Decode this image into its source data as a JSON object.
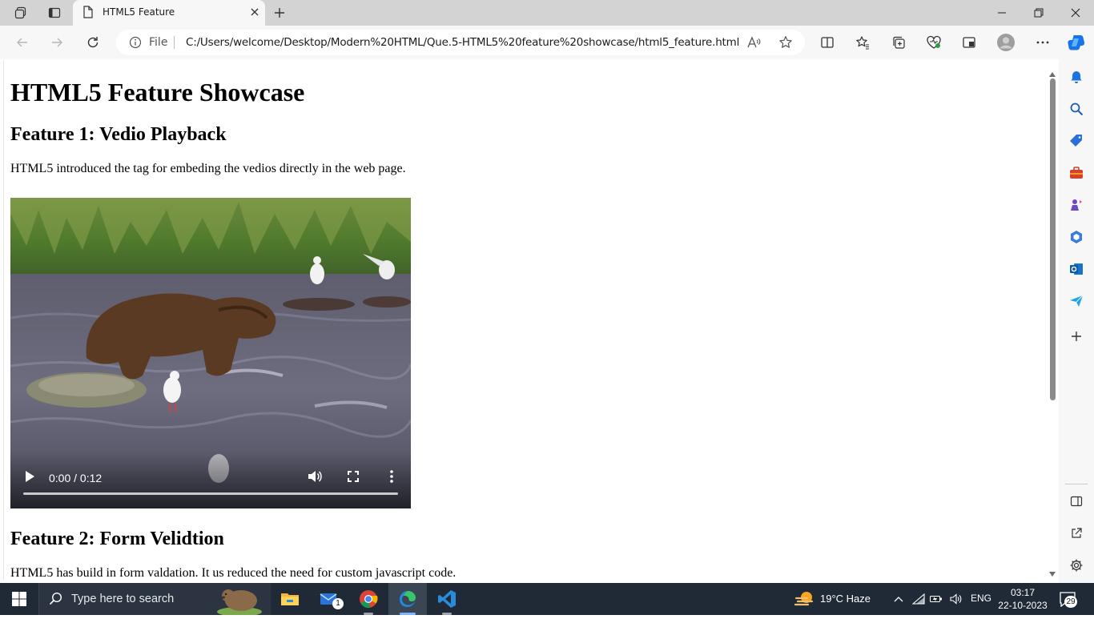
{
  "browser": {
    "tab": {
      "title": "HTML5 Feature"
    },
    "address": {
      "scheme_label": "File",
      "url": "C:/Users/welcome/Desktop/Modern%20HTML/Que.5-HTML5%20feature%20showcase/html5_feature.html"
    }
  },
  "page": {
    "title": "HTML5 Feature Showcase",
    "feature1": {
      "heading": "Feature 1: Vedio Playback",
      "text": "HTML5 introduced the tag for embeding the vedios directly in the web page.",
      "video": {
        "time": "0:00 / 0:12",
        "progress": 0
      }
    },
    "feature2": {
      "heading": "Feature 2: Form Velidtion",
      "text": "HTML5 has build in form valdation. It us reduced the need for custom javascript code."
    }
  },
  "taskbar": {
    "search_placeholder": "Type here to search",
    "weather": "19°C  Haze",
    "language": "ENG",
    "time": "03:17",
    "date": "22-10-2023",
    "notifications": "29",
    "mail_badge": "1"
  },
  "colors": {
    "edge_accent": "#0c59a4",
    "copilot": "#1a73e8"
  }
}
